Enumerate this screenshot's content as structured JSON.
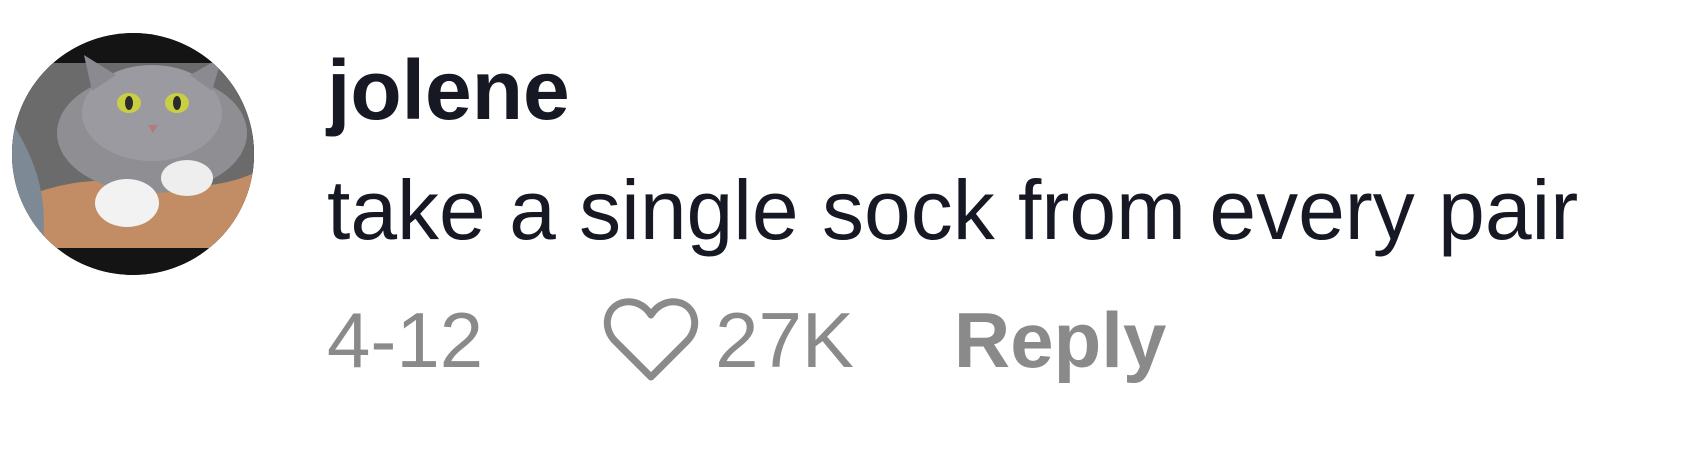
{
  "comment": {
    "avatar_icon": "cat-avatar",
    "username": "jolene",
    "text": "take a single sock from every pair",
    "date": "4-12",
    "like_icon": "heart-outline-icon",
    "like_count": "27K",
    "reply_label": "Reply"
  },
  "colors": {
    "primary_text": "#161823",
    "secondary_text": "#8a8a8a",
    "background": "#ffffff"
  }
}
